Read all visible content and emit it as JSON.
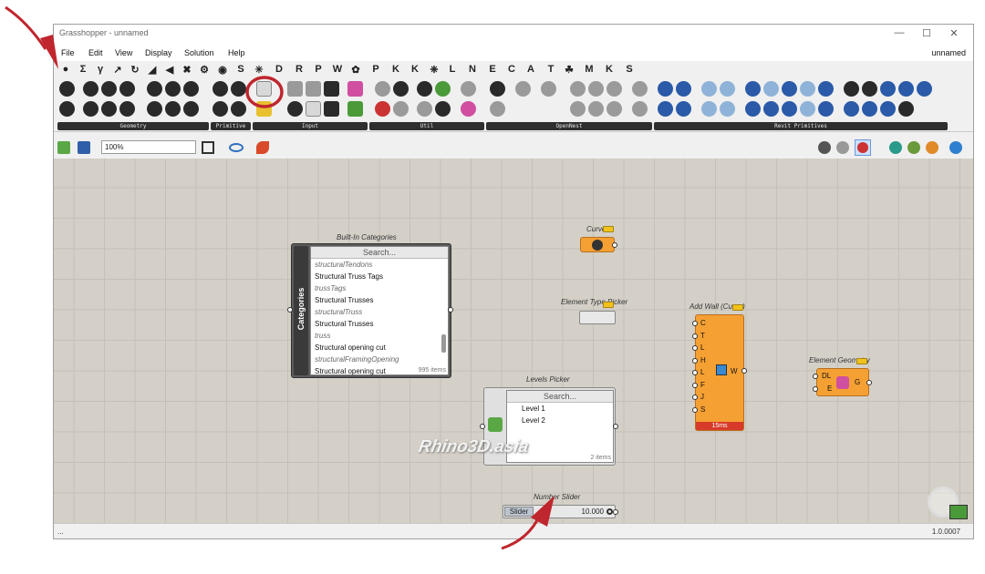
{
  "window": {
    "title": "Grasshopper - unnamed",
    "doc_name": "unnamed"
  },
  "menu": [
    "File",
    "Edit",
    "View",
    "Display",
    "Solution",
    "Help"
  ],
  "tabs": [
    "●",
    "Σ",
    "γ",
    "↗",
    "↻",
    "◢",
    "◀",
    "✖",
    "⚙",
    "◉",
    "S",
    "✳",
    "D",
    "R",
    "P",
    "W",
    "✿",
    "P",
    "K",
    "K",
    "❈",
    "L",
    "N",
    "E",
    "C",
    "A",
    "T",
    "☘",
    "M",
    "K",
    "S"
  ],
  "ribbon": {
    "panels": [
      "Geometry",
      "Primitive",
      "Input",
      "Util",
      "OpenNest",
      "Revit Primitives"
    ]
  },
  "toolbar": {
    "zoom": "100%"
  },
  "canvas": {
    "categories": {
      "title": "Built-In Categories",
      "search": "Search...",
      "side_label": "Categories",
      "items": [
        {
          "text": "structuralTendons",
          "sub": true
        },
        {
          "text": "Structural Truss Tags",
          "sub": false
        },
        {
          "text": "trussTags",
          "sub": true
        },
        {
          "text": "Structural Trusses",
          "sub": false
        },
        {
          "text": "structuralTruss",
          "sub": true
        },
        {
          "text": "Structural Trusses",
          "sub": false
        },
        {
          "text": "truss",
          "sub": true
        },
        {
          "text": "Structural opening cut",
          "sub": false
        },
        {
          "text": "structuralFramingOpening",
          "sub": true
        },
        {
          "text": "Structural opening cut",
          "sub": false
        }
      ],
      "count": "995 items"
    },
    "curve": {
      "title": "Curve"
    },
    "element_type_picker": {
      "title": "Element Type Picker"
    },
    "add_wall": {
      "title": "Add Wall (Curve)",
      "inputs": [
        "C",
        "T",
        "L",
        "H",
        "L",
        "F",
        "J",
        "S"
      ],
      "output": "W",
      "time": "15ms"
    },
    "element_geometry": {
      "title": "Element Geometry",
      "inputs": [
        "DL",
        "E"
      ],
      "output": "G"
    },
    "levels_picker": {
      "title": "Levels Picker",
      "search": "Search...",
      "items": [
        "Level 1",
        "Level 2"
      ],
      "count": "2 items"
    },
    "number_slider": {
      "title": "Number Slider",
      "label": "Slider",
      "value": "10.000"
    },
    "watermark": "Rhino3D.asia"
  },
  "status": {
    "left": "...",
    "version": "1.0.0007"
  },
  "colors": {
    "component": "#f5a033",
    "annotation": "#c0262d",
    "canvas": "#d4d0c8"
  }
}
